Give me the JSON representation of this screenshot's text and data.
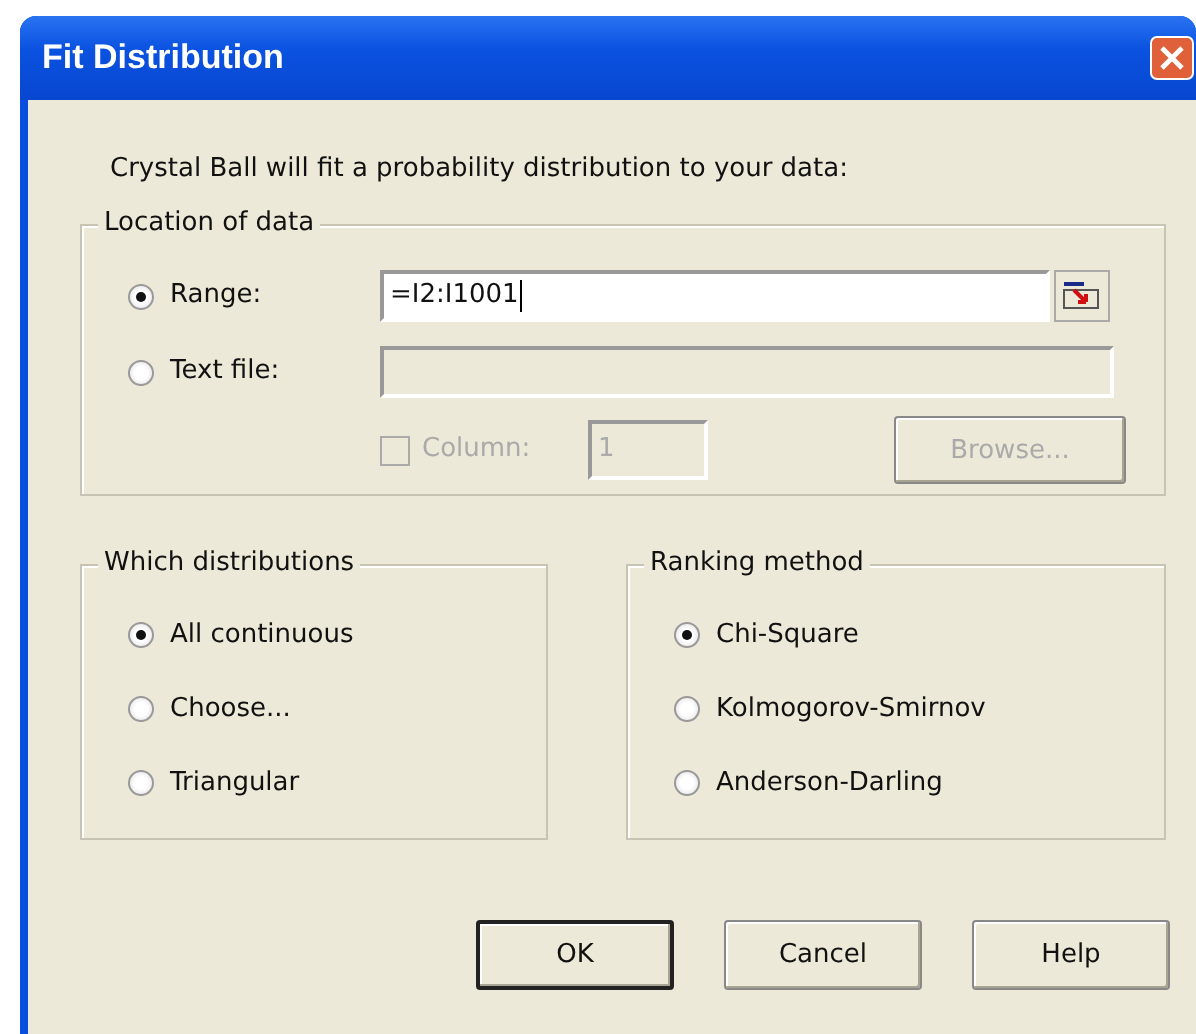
{
  "window": {
    "title": "Fit Distribution"
  },
  "intro": "Crystal Ball will fit a probability distribution to your data:",
  "location": {
    "legend": "Location of data",
    "sources": [
      {
        "label": "Range:",
        "selected": true,
        "value": "=I2:I1001",
        "disabled": false
      },
      {
        "label": "Text file:",
        "selected": false,
        "disabled": true
      }
    ],
    "column": {
      "label": "Column:",
      "checked": false,
      "disabled": true,
      "value": "1"
    },
    "browse": {
      "label": "Browse...",
      "disabled": true
    }
  },
  "distributions": {
    "legend": "Which distributions",
    "options": [
      {
        "label": "All continuous",
        "selected": true
      },
      {
        "label": "Choose...",
        "selected": false
      },
      {
        "label": "Triangular",
        "selected": false
      }
    ]
  },
  "ranking": {
    "legend": "Ranking method",
    "options": [
      {
        "label": "Chi-Square",
        "selected": true
      },
      {
        "label": "Kolmogorov-Smirnov",
        "selected": false
      },
      {
        "label": "Anderson-Darling",
        "selected": false
      }
    ]
  },
  "buttons": [
    {
      "label": "OK",
      "default": true
    },
    {
      "label": "Cancel",
      "default": false
    },
    {
      "label": "Help",
      "default": false
    }
  ]
}
